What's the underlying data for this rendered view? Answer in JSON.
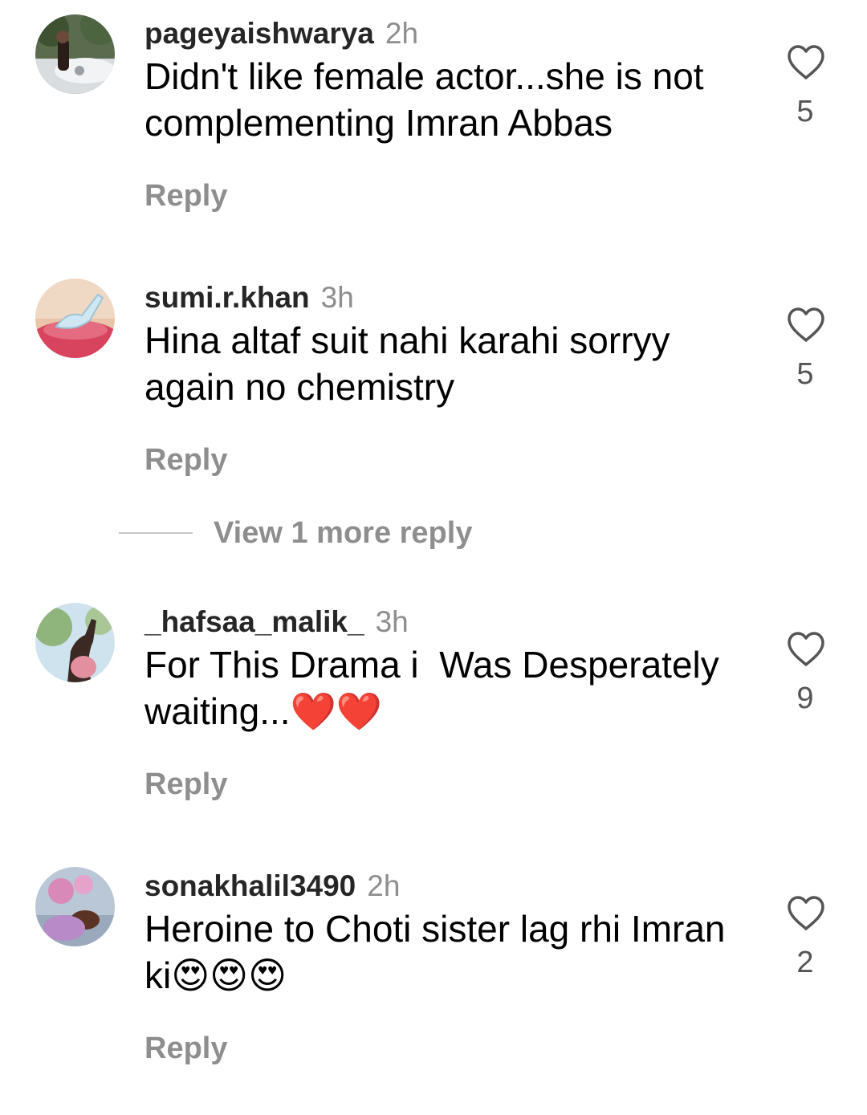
{
  "comments": [
    {
      "username": "pageyaishwarya",
      "time": "2h",
      "text": "Didn't like female actor...she is not complementing Imran Abbas",
      "reply_label": "Reply",
      "likes": "5"
    },
    {
      "username": "sumi.r.khan",
      "time": "3h",
      "text": "Hina altaf suit nahi karahi sorryy again no chemistry",
      "reply_label": "Reply",
      "likes": "5"
    },
    {
      "username": "_hafsaa_malik_",
      "time": "3h",
      "text": "For This Drama i  Was Desperately waiting...❤️❤️",
      "reply_label": "Reply",
      "likes": "9"
    },
    {
      "username": "sonakhalil3490",
      "time": "2h",
      "text": "Heroine to Choti sister lag rhi Imran ki😍😍😍",
      "reply_label": "Reply",
      "likes": "2"
    }
  ],
  "view_more_replies": "View 1 more reply",
  "icons": {
    "like": "heart-outline-icon"
  },
  "colors": {
    "username": "#262626",
    "secondary_text": "#8e8e8e",
    "body_text": "#000000"
  }
}
